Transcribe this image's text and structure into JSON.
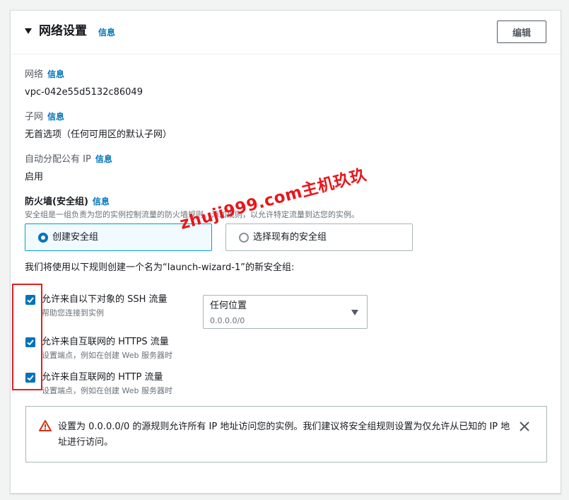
{
  "header": {
    "title": "网络设置",
    "info": "信息",
    "edit_label": "编辑"
  },
  "network": {
    "label": "网络",
    "info": "信息",
    "value": "vpc-042e55d5132c86049"
  },
  "subnet": {
    "label": "子网",
    "info": "信息",
    "value": "无首选项（任何可用区的默认子网）"
  },
  "public_ip": {
    "label": "自动分配公有 IP",
    "info": "信息",
    "value": "启用"
  },
  "firewall": {
    "label": "防火墙(安全组)",
    "info": "信息",
    "description": "安全组是一组负责为您的实例控制流量的防火墙规则。添加规则，以允许特定流量到达您的实例。",
    "options": [
      {
        "label": "创建安全组",
        "selected": true
      },
      {
        "label": "选择现有的安全组",
        "selected": false
      }
    ],
    "intro": "我们将使用以下规则创建一个名为“launch-wizard-1”的新安全组:"
  },
  "rules": [
    {
      "title": "允许来自以下对象的 SSH 流量",
      "description": "帮助您连接到实例",
      "checked": true
    },
    {
      "title": "允许来自互联网的 HTTPS 流量",
      "description": "设置端点，例如在创建 Web 服务器时",
      "checked": true
    },
    {
      "title": "允许来自互联网的 HTTP 流量",
      "description": "设置端点，例如在创建 Web 服务器时",
      "checked": true
    }
  ],
  "ssh_source": {
    "value": "任何位置",
    "sub": "0.0.0.0/0"
  },
  "alert": {
    "message": "设置为 0.0.0.0/0 的源规则允许所有 IP 地址访问您的实例。我们建议将安全组规则设置为仅允许从已知的 IP 地址进行访问。",
    "icon": "warning-icon"
  },
  "watermark": "zhuji999.com主机玖玖",
  "colors": {
    "accent": "#0073bb",
    "warning": "#d13212",
    "highlight": "#e02020"
  }
}
